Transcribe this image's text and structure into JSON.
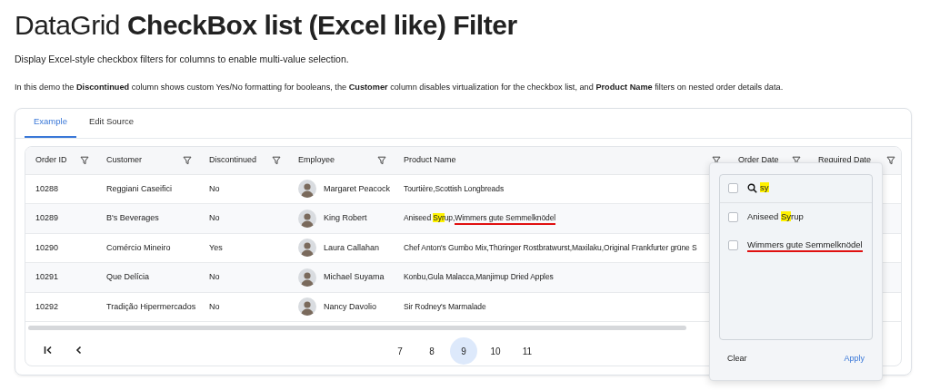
{
  "page": {
    "title_light": "DataGrid",
    "title_bold": "CheckBox list (Excel like) Filter",
    "lead": "Display Excel-style checkbox filters for columns to enable multi-value selection.",
    "note": "In this demo the **Discontinued** column shows custom Yes/No formatting for booleans, the **Customer** column disables virtualization for the checkbox list, and **Product Name** filters on nested order details data."
  },
  "tabs": [
    {
      "label": "Example",
      "selected": true
    },
    {
      "label": "Edit Source",
      "selected": false
    }
  ],
  "table": {
    "columns": [
      {
        "label": "Order ID"
      },
      {
        "label": "Customer"
      },
      {
        "label": "Discontinued"
      },
      {
        "label": "Employee"
      },
      {
        "label": "Product Name"
      },
      {
        "label": "Order Date"
      },
      {
        "label": "Required Date"
      }
    ],
    "rows": [
      {
        "order_id": "10288",
        "customer": "Reggiani Caseifici",
        "discontinued": "No",
        "employee": "Margaret Peacock",
        "product": [
          {
            "text": "Tourtière,Scottish Longbreads",
            "highlighted": false,
            "underlined": false
          }
        ]
      },
      {
        "order_id": "10289",
        "customer": "B's Beverages",
        "discontinued": "No",
        "employee": "King Robert",
        "product": [
          {
            "text": "Aniseed ",
            "highlighted": false,
            "underlined": false
          },
          {
            "text": "Syr",
            "highlighted": true,
            "underlined": false
          },
          {
            "text": "up,",
            "highlighted": false,
            "underlined": false
          },
          {
            "text": "Wimmers gute Semmelknödel",
            "highlighted": false,
            "underlined": true
          }
        ]
      },
      {
        "order_id": "10290",
        "customer": "Comércio Mineiro",
        "discontinued": "Yes",
        "employee": "Laura Callahan",
        "product": [
          {
            "text": "Chef Anton's Gumbo Mix,Thüringer Rostbratwurst,Maxilaku,Original Frankfurter grüne S",
            "highlighted": false,
            "underlined": false
          }
        ]
      },
      {
        "order_id": "10291",
        "customer": "Que Delícia",
        "discontinued": "No",
        "employee": "Michael Suyama",
        "product": [
          {
            "text": "Konbu,Gula Malacca,Manjimup Dried Apples",
            "highlighted": false,
            "underlined": false
          }
        ]
      },
      {
        "order_id": "10292",
        "customer": "Tradição Hipermercados",
        "discontinued": "No",
        "employee": "Nancy Davolio",
        "product": [
          {
            "text": "Sir Rodney's Marmalade",
            "highlighted": false,
            "underlined": false
          }
        ]
      }
    ]
  },
  "pagination": {
    "pages": [
      {
        "label": "7",
        "selected": false
      },
      {
        "label": "8",
        "selected": false
      },
      {
        "label": "9",
        "selected": true
      },
      {
        "label": "10",
        "selected": false
      },
      {
        "label": "11",
        "selected": false
      }
    ]
  },
  "filter_popup": {
    "options": [
      {
        "kind": "search",
        "checked": false,
        "segments": [
          {
            "text": "sy",
            "highlighted": true,
            "underlined": false
          }
        ]
      },
      {
        "kind": "option",
        "checked": false,
        "segments": [
          {
            "text": "Aniseed ",
            "highlighted": false,
            "underlined": false
          },
          {
            "text": "Sy",
            "highlighted": true,
            "underlined": false
          },
          {
            "text": "rup",
            "highlighted": false,
            "underlined": false
          }
        ]
      },
      {
        "kind": "option",
        "checked": false,
        "segments": [
          {
            "text": "Wimmers gute Semmelknödel",
            "highlighted": false,
            "underlined": true
          }
        ]
      }
    ],
    "buttons": [
      {
        "label": "Clear",
        "kind": "secondary"
      },
      {
        "label": "Apply",
        "kind": "primary"
      }
    ]
  }
}
